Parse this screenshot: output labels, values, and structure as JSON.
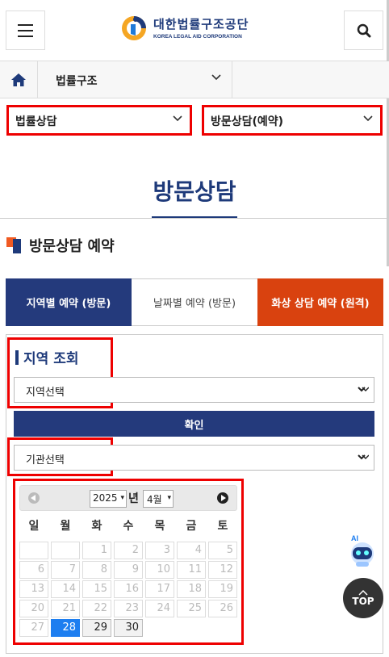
{
  "header": {
    "logo_ko": "대한법률구조공단",
    "logo_en": "KOREA LEGAL AID CORPORATION"
  },
  "breadcrumb": {
    "level1": "법률구조",
    "level2": "법률상담",
    "level3": "방문상담(예약)"
  },
  "page": {
    "title": "방문상담",
    "section": "방문상담 예약"
  },
  "tabs": [
    {
      "label": "지역별 예약 (방문)"
    },
    {
      "label": "날짜별 예약 (방문)"
    },
    {
      "label": "화상 상담 예약 (원격)"
    }
  ],
  "form": {
    "region_heading": "지역 조회",
    "region_select": "지역선택",
    "confirm_label": "확인",
    "org_select": "기관선택"
  },
  "calendar": {
    "year": "2025",
    "year_suffix": "년",
    "month": "4월",
    "weekdays": [
      "일",
      "월",
      "화",
      "수",
      "목",
      "금",
      "토"
    ],
    "days": [
      {
        "d": "1"
      },
      {
        "d": "2"
      },
      {
        "d": "3"
      },
      {
        "d": "4"
      },
      {
        "d": "5"
      },
      {
        "d": "6"
      },
      {
        "d": "7"
      },
      {
        "d": "8"
      },
      {
        "d": "9"
      },
      {
        "d": "10"
      },
      {
        "d": "11"
      },
      {
        "d": "12"
      },
      {
        "d": "13"
      },
      {
        "d": "14"
      },
      {
        "d": "15"
      },
      {
        "d": "16"
      },
      {
        "d": "17"
      },
      {
        "d": "18"
      },
      {
        "d": "19"
      },
      {
        "d": "20"
      },
      {
        "d": "21"
      },
      {
        "d": "22"
      },
      {
        "d": "23"
      },
      {
        "d": "24"
      },
      {
        "d": "25"
      },
      {
        "d": "26"
      },
      {
        "d": "27"
      },
      {
        "d": "28"
      },
      {
        "d": "29"
      },
      {
        "d": "30"
      }
    ]
  },
  "floats": {
    "ai_label": "AI",
    "top_label": "TOP"
  },
  "colors": {
    "navy": "#243a7c",
    "orange": "#d9420f",
    "highlight": "#ee0000",
    "today": "#1d7ef0"
  }
}
